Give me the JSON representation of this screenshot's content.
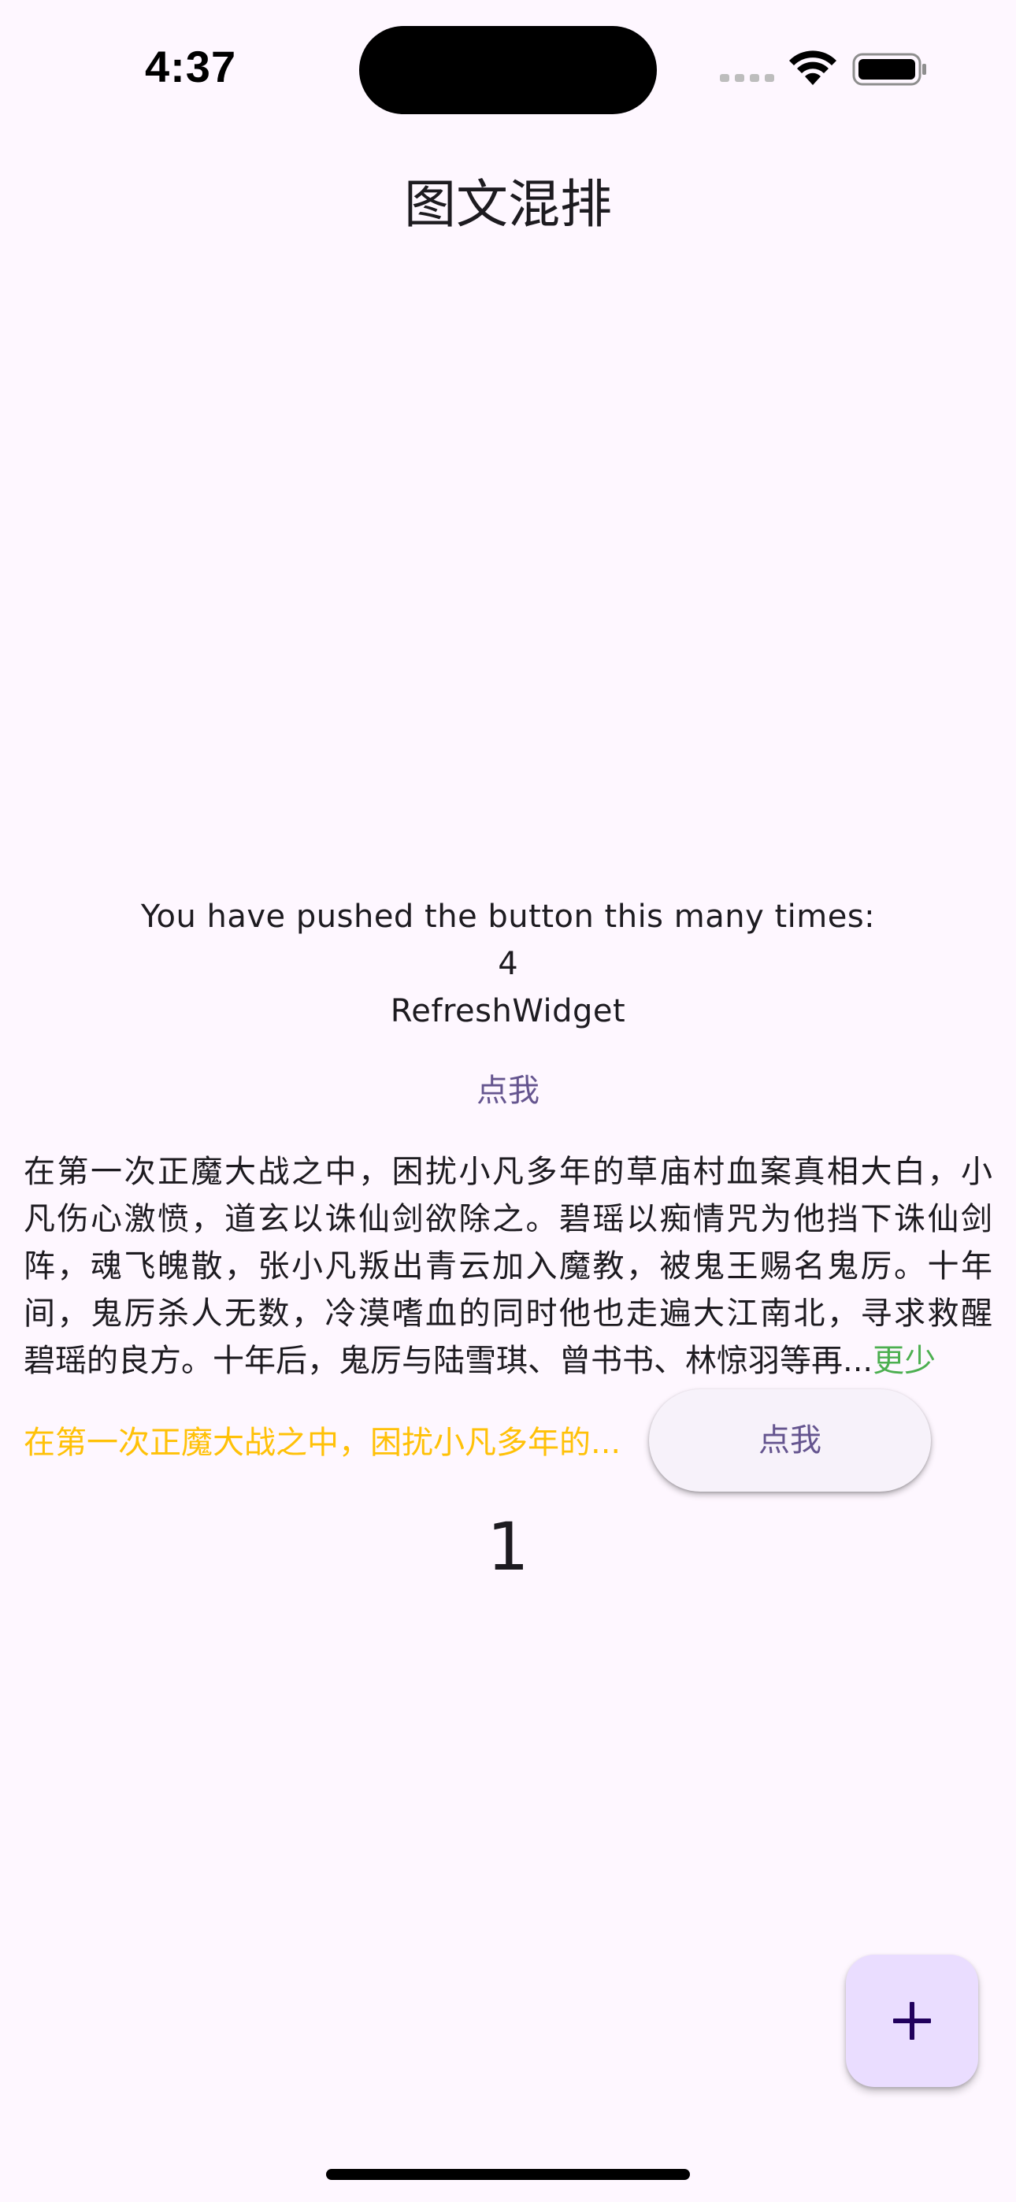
{
  "status_bar": {
    "time": "4:37"
  },
  "app_bar": {
    "title": "图文混排"
  },
  "counter": {
    "label": "You have pushed the button this many times:",
    "value": "4",
    "widget_label": "RefreshWidget"
  },
  "text_button": {
    "label": "点我"
  },
  "article": {
    "lines": [
      "在第一次正魔大战之中，困扰小凡多年的草庙村血案真相大白，小",
      "凡伤心激愤，道玄以诛仙剑欲除之。碧瑶以痴情咒为他挡下诛仙剑",
      "阵，魂飞魄散，张小凡叛出青云加入魔教，被鬼王赐名鬼厉。十年",
      "间，鬼厉杀人无数，冷漠嗜血的同时他也走遍大江南北，寻求救醒",
      "碧瑶的良方。十年后，鬼厉与陆雪琪、曾书书、林惊羽等再..."
    ],
    "toggle_label": "更少",
    "toggle_color": "#4CAF50"
  },
  "collapsed_article": {
    "text": "在第一次正魔大战之中，困扰小凡多年的...",
    "color": "#FFC107"
  },
  "pill_button": {
    "label": "点我"
  },
  "big_number": "1",
  "fab": {
    "icon": "plus-icon",
    "background": "#EADDFF"
  },
  "theme": {
    "background": "#FEF7FF",
    "primary": "#65558F"
  }
}
